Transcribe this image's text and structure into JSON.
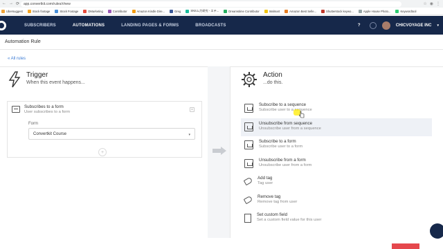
{
  "browser": {
    "url": "app.convertkit.com/rules/r/new",
    "bookmarks": [
      "Ubersuggest",
      "Stock footage",
      "Stock Footage",
      "DMarketing",
      "Contributor",
      "Amazon Kindle Dire...",
      "Greg",
      "SNSム力研究 - エテ...",
      "Dreamstime Contributor",
      "Walmart",
      "Amazon Best Selle...",
      "Shutterstock keywo...",
      "Apple House Photo...",
      "Keywordtool"
    ]
  },
  "nav": {
    "links": [
      "SUBSCRIBERS",
      "AUTOMATIONS",
      "LANDING PAGES & FORMS",
      "BROADCASTS"
    ],
    "account": "CHICVOYAGE INC",
    "help": "?"
  },
  "page": {
    "title": "Automation Rule",
    "back_link": "« All rules"
  },
  "trigger": {
    "title": "Trigger",
    "subtitle": "When this event happens...",
    "selected": {
      "title": "Subscribes to a form",
      "sub": "User subscribes to a form"
    },
    "form_label": "Form",
    "form_value": "Convertkit Course"
  },
  "action": {
    "title": "Action",
    "subtitle": "...do this.",
    "items": [
      {
        "title": "Subscribe to a sequence",
        "sub": "Subscribe user to a sequence",
        "icon": "box-icon"
      },
      {
        "title": "Unsubscribe from sequence",
        "sub": "Unsubscribe user from a sequence",
        "icon": "box-icon"
      },
      {
        "title": "Subscribe to a form",
        "sub": "Subscribe user to a form",
        "icon": "card-icon"
      },
      {
        "title": "Unsubscribe from a form",
        "sub": "Unsubscribe user from a form",
        "icon": "card-icon"
      },
      {
        "title": "Add tag",
        "sub": "Tag user",
        "icon": "tag-icon"
      },
      {
        "title": "Remove tag",
        "sub": "Remove tag from user",
        "icon": "tag-icon"
      },
      {
        "title": "Set custom field",
        "sub": "Set a custom field value for this user",
        "icon": "document-icon"
      }
    ]
  },
  "colors": {
    "nav_bg": "#16284a",
    "link": "#3b7bd4",
    "hover_row": "#eef1f6"
  }
}
